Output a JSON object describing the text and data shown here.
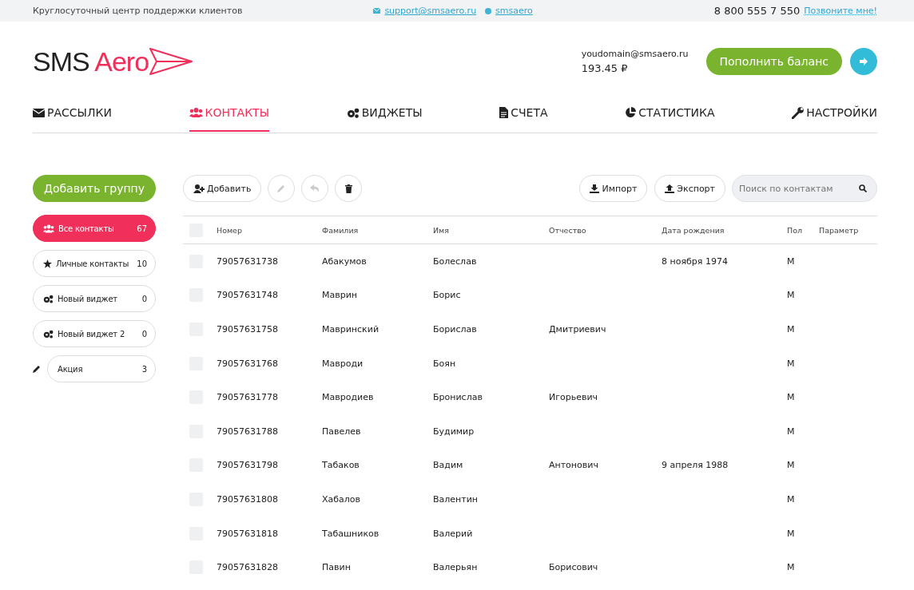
{
  "top_bar": {
    "support_text": "Круглосуточный центр поддержки клиентов",
    "email": "support@smsaero.ru",
    "skype": "smsaero",
    "phone": "8 800 555 7 550",
    "callback_link": "Позвоните мне!"
  },
  "header": {
    "logo_left": "SMS",
    "logo_right": "Aero",
    "account_email": "youdomain@smsaero.ru",
    "balance": "193.45 ₽",
    "topup_button": "Пополнить баланс"
  },
  "nav": [
    {
      "label": "РАССЫЛКИ",
      "kind": "mail",
      "selected": false
    },
    {
      "label": "КОНТАКТЫ",
      "kind": "users",
      "selected": true
    },
    {
      "label": "ВИДЖЕТЫ",
      "kind": "gears",
      "selected": false
    },
    {
      "label": "СЧЕТА",
      "kind": "file",
      "selected": false
    },
    {
      "label": "СТАТИСТИКА",
      "kind": "pie",
      "selected": false
    },
    {
      "label": "НАСТРОЙКИ",
      "kind": "wrench",
      "selected": false
    }
  ],
  "sidebar": {
    "add_group_button": "Добавить группу",
    "groups": [
      {
        "label": "Все контакты",
        "count": "67",
        "kind": "users",
        "selected": true
      },
      {
        "label": "Личные контакты",
        "count": "10",
        "kind": "star",
        "selected": false
      },
      {
        "label": "Новый виджет",
        "count": "0",
        "kind": "gears",
        "selected": false
      },
      {
        "label": "Новый виджет 2",
        "count": "0",
        "kind": "gears",
        "selected": false
      },
      {
        "label": "Акция",
        "count": "3",
        "kind": "editable",
        "selected": false
      }
    ]
  },
  "toolbar": {
    "add_button": "Добавить",
    "import_button": "Импорт",
    "export_button": "Экспорт",
    "search": {
      "placeholder": "Поиск по контактам"
    }
  },
  "table": {
    "header_checked": false,
    "columns": [
      "Номер",
      "Фамилия",
      "Имя",
      "Отчество",
      "Дата рождения",
      "Пол",
      "Параметр"
    ],
    "rows": [
      {
        "checked": false,
        "cells": [
          "79057631738",
          "Абакумов",
          "Болеслав",
          "",
          "8 ноября 1974",
          "М",
          ""
        ]
      },
      {
        "checked": false,
        "cells": [
          "79057631748",
          "Маврин",
          "Борис",
          "",
          "",
          "М",
          ""
        ]
      },
      {
        "checked": false,
        "cells": [
          "79057631758",
          "Мавринский",
          "Борислав",
          "Дмитриевич",
          "",
          "М",
          ""
        ]
      },
      {
        "checked": false,
        "cells": [
          "79057631768",
          "Мавроди",
          "Боян",
          "",
          "",
          "М",
          ""
        ]
      },
      {
        "checked": false,
        "cells": [
          "79057631778",
          "Мавродиев",
          "Бронислав",
          "Игорьевич",
          "",
          "М",
          ""
        ]
      },
      {
        "checked": false,
        "cells": [
          "79057631788",
          "Павелев",
          "Будимир",
          "",
          "",
          "М",
          ""
        ]
      },
      {
        "checked": false,
        "cells": [
          "79057631798",
          "Табаков",
          "Вадим",
          "Антонович",
          "9 апреля 1988",
          "М",
          ""
        ]
      },
      {
        "checked": false,
        "cells": [
          "79057631808",
          "Хабалов",
          "Валентин",
          "",
          "",
          "М",
          ""
        ]
      },
      {
        "checked": false,
        "cells": [
          "79057631818",
          "Табашников",
          "Валерий",
          "",
          "",
          "М",
          ""
        ]
      },
      {
        "checked": false,
        "cells": [
          "79057631828",
          "Павин",
          "Валерьян",
          "Борисович",
          "",
          "М",
          ""
        ]
      }
    ]
  }
}
